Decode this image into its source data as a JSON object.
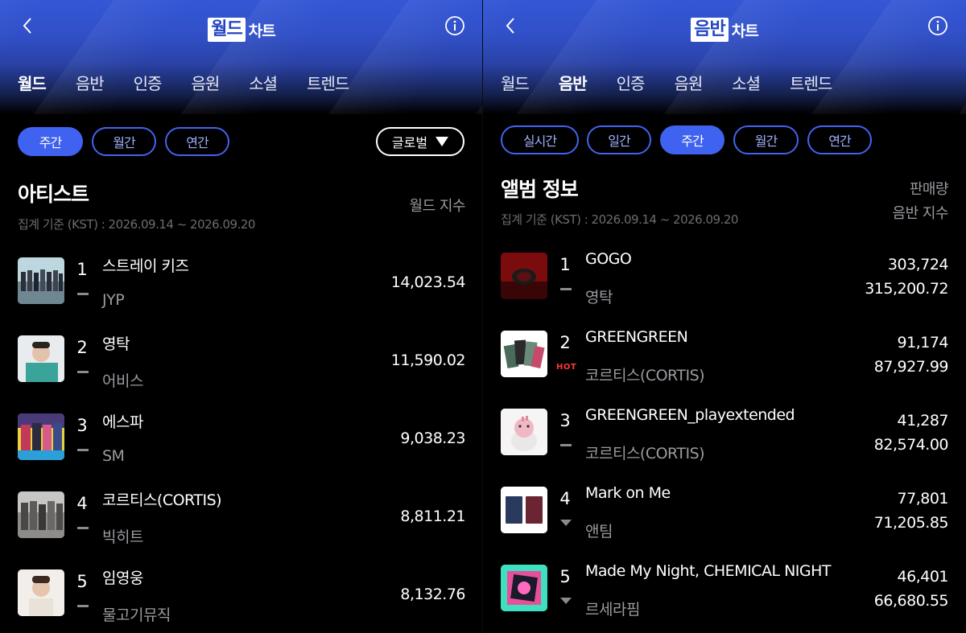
{
  "left": {
    "title_highlight": "월드",
    "title_rest": "차트",
    "tabs": [
      "월드",
      "음반",
      "인증",
      "음원",
      "소셜",
      "트렌드"
    ],
    "active_tab": "월드",
    "periods": [
      "주간",
      "월간",
      "연간"
    ],
    "active_period": "주간",
    "region": "글로벌",
    "section_title": "아티스트",
    "date_range": "집계 기준 (KST) : 2026.09.14 ~ 2026.09.20",
    "column_header": "월드 지수",
    "rows": [
      {
        "rank": "1",
        "name": "스트레이 키즈",
        "agency": "JYP",
        "score": "14,023.54",
        "trend": "same"
      },
      {
        "rank": "2",
        "name": "영탁",
        "agency": "어비스",
        "score": "11,590.02",
        "trend": "same"
      },
      {
        "rank": "3",
        "name": "에스파",
        "agency": "SM",
        "score": "9,038.23",
        "trend": "same"
      },
      {
        "rank": "4",
        "name": "코르티스(CORTIS)",
        "agency": "빅히트",
        "score": "8,811.21",
        "trend": "same"
      },
      {
        "rank": "5",
        "name": "임영웅",
        "agency": "물고기뮤직",
        "score": "8,132.76",
        "trend": "same"
      }
    ]
  },
  "right": {
    "title_highlight": "음반",
    "title_rest": "차트",
    "tabs": [
      "월드",
      "음반",
      "인증",
      "음원",
      "소셜",
      "트렌드"
    ],
    "active_tab": "음반",
    "periods": [
      "실시간",
      "일간",
      "주간",
      "월간",
      "연간"
    ],
    "active_period": "주간",
    "section_title": "앨범 정보",
    "date_range": "집계 기준 (KST) : 2026.09.14 ~ 2026.09.20",
    "column_header_1": "판매량",
    "column_header_2": "음반 지수",
    "rows": [
      {
        "rank": "1",
        "title": "GOGO",
        "artist": "영탁",
        "sales": "303,724",
        "index": "315,200.72",
        "trend": "same",
        "badge": ""
      },
      {
        "rank": "2",
        "title": "GREENGREEN",
        "artist": "코르티스(CORTIS)",
        "sales": "91,174",
        "index": "87,927.99",
        "trend": "hot",
        "badge": "HOT"
      },
      {
        "rank": "3",
        "title": "GREENGREEN_playextended",
        "artist": "코르티스(CORTIS)",
        "sales": "41,287",
        "index": "82,574.00",
        "trend": "same",
        "badge": ""
      },
      {
        "rank": "4",
        "title": "Mark on Me",
        "artist": "앤팀",
        "sales": "77,801",
        "index": "71,205.85",
        "trend": "down",
        "badge": ""
      },
      {
        "rank": "5",
        "title": "Made My Night, CHEMICAL NIGHT",
        "artist": "르세라핌",
        "sales": "46,401",
        "index": "66,680.55",
        "trend": "down",
        "badge": ""
      }
    ]
  }
}
